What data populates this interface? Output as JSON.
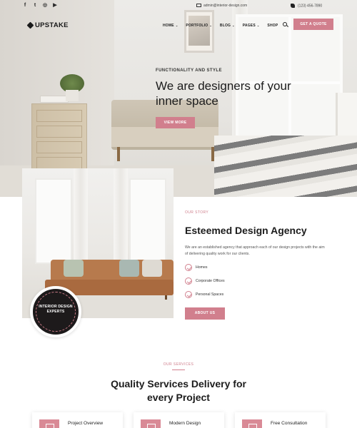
{
  "topbar": {
    "social": [
      "f",
      "t",
      "◎",
      "▶"
    ],
    "email": "admin@interior-design.com",
    "phone": "(123) 456-7890"
  },
  "nav": {
    "logo": "UPSTAKE",
    "items": [
      {
        "label": "HOME",
        "has_dropdown": true
      },
      {
        "label": "PORTFOLIO",
        "has_dropdown": true
      },
      {
        "label": "BLOG",
        "has_dropdown": true
      },
      {
        "label": "PAGES",
        "has_dropdown": true
      },
      {
        "label": "SHOP",
        "has_dropdown": false
      }
    ],
    "search_icon": "search-icon",
    "cta": "GET A QUOTE"
  },
  "hero": {
    "kicker": "FUNCTIONALITY AND STYLE",
    "title": "We are designers of your inner space",
    "button": "VIEW MORE"
  },
  "about": {
    "badge": "INTERIOR DESIGN EXPERTS",
    "kicker": "OUR STORY",
    "title": "Esteemed Design Agency",
    "text": "We are an established agency that approach each of our design projects with the aim of delivering quality work for our clients.",
    "checklist": [
      "Homes",
      "Corporate Offices",
      "Personal Spaces"
    ],
    "button": "ABOUT US"
  },
  "services": {
    "kicker": "OUR SERVICES",
    "title_line1": "Quality Services Delivery for",
    "title_line2": "every Project",
    "cards": [
      "Project Overview",
      "Modern Design",
      "Free Consultation"
    ]
  },
  "colors": {
    "accent": "#d17f8d",
    "dark": "#1d1a1b",
    "text": "#1c1c1c"
  }
}
